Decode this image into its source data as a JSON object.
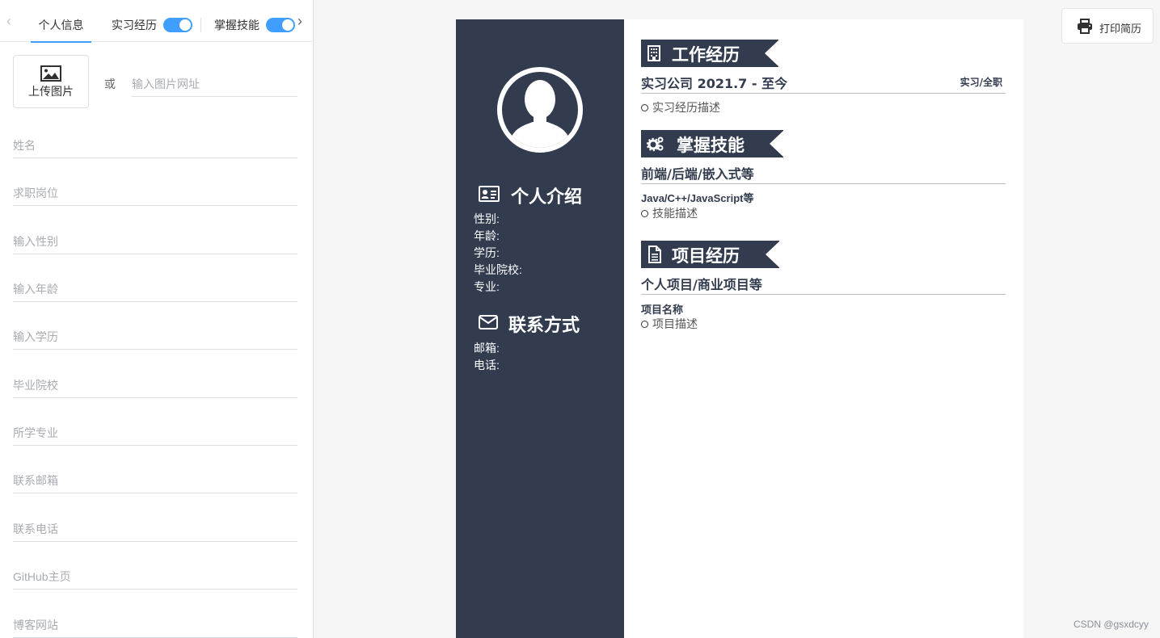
{
  "editor": {
    "tabs": [
      {
        "label": "个人信息",
        "active": true
      },
      {
        "label": "实习经历",
        "toggle": true
      },
      {
        "label": "掌握技能",
        "toggle": true
      }
    ],
    "upload_label": "上传图片",
    "or_label": "或",
    "url_placeholder": "输入图片网址",
    "fields": [
      {
        "placeholder": "姓名"
      },
      {
        "placeholder": "求职岗位"
      },
      {
        "placeholder": "输入性别"
      },
      {
        "placeholder": "输入年龄"
      },
      {
        "placeholder": "输入学历"
      },
      {
        "placeholder": "毕业院校"
      },
      {
        "placeholder": "所学专业"
      },
      {
        "placeholder": "联系邮箱"
      },
      {
        "placeholder": "联系电话"
      },
      {
        "placeholder": "GitHub主页"
      },
      {
        "placeholder": "博客网站"
      }
    ]
  },
  "resume": {
    "side": {
      "intro_title": "个人介绍",
      "intro_lines": [
        "性别:",
        "年龄:",
        "学历:",
        "毕业院校:",
        "专业:"
      ],
      "contact_title": "联系方式",
      "contact_lines": [
        "邮箱:",
        "电话:"
      ]
    },
    "work": {
      "title": "工作经历",
      "company": "实习公司 2021.7 - 至今",
      "type": "实习/全职",
      "desc": "实习经历描述"
    },
    "skills": {
      "title": "掌握技能",
      "category": "前端/后端/嵌入式等",
      "list": "Java/C++/JavaScript等",
      "desc": "技能描述"
    },
    "projects": {
      "title": "项目经历",
      "category": "个人项目/商业项目等",
      "name": "项目名称",
      "desc": "项目描述"
    }
  },
  "print_label": "打印简历",
  "watermark": "CSDN @gsxdcyy",
  "colors": {
    "accent": "#409eff",
    "resume_dark": "#323c4e"
  }
}
